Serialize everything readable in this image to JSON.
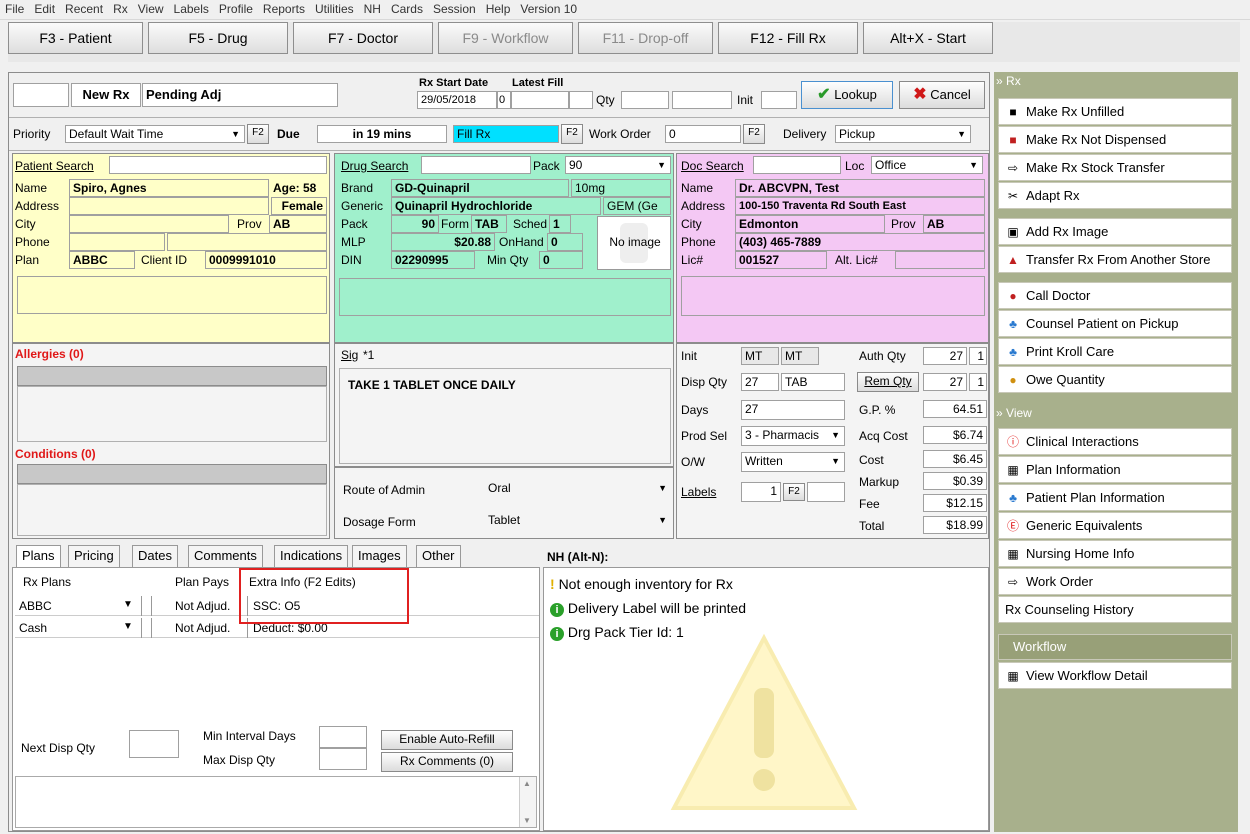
{
  "menu": [
    "File",
    "Edit",
    "Recent",
    "Rx",
    "View",
    "Labels",
    "Profile",
    "Reports",
    "Utilities",
    "NH",
    "Cards",
    "Session",
    "Help",
    "Version 10"
  ],
  "fkeys": [
    "F3 - Patient",
    "F5 - Drug",
    "F7 - Doctor",
    "F9 - Workflow",
    "F11 - Drop-off",
    "F12 - Fill Rx",
    "Alt+X - Start"
  ],
  "header": {
    "new_rx": "New Rx",
    "pending": "Pending Adj",
    "rx_start_label": "Rx Start Date",
    "latest_fill_label": "Latest Fill",
    "rx_start": "29/05/2018",
    "latest_fill": "0",
    "qty_label": "Qty",
    "init_label": "Init",
    "lookup": "Lookup",
    "cancel": "Cancel"
  },
  "priority": {
    "label": "Priority",
    "value": "Default Wait Time",
    "f2": "F2",
    "due_label": "Due",
    "due": "in 19 mins",
    "fill": "Fill Rx",
    "work_order_label": "Work Order",
    "work_order": "0",
    "delivery_label": "Delivery",
    "delivery": "Pickup"
  },
  "patient": {
    "search_label": "Patient Search",
    "name_label": "Name",
    "name": "Spiro, Agnes",
    "age": "Age: 58",
    "address_label": "Address",
    "gender": "Female",
    "city_label": "City",
    "prov_label": "Prov",
    "prov": "AB",
    "phone_label": "Phone",
    "plan_label": "Plan",
    "plan": "ABBC",
    "client_id_label": "Client ID",
    "client_id": "0009991010"
  },
  "drug": {
    "search_label": "Drug Search",
    "pack_label": "Pack",
    "pack": "90",
    "brand_label": "Brand",
    "brand": "GD-Quinapril",
    "strength": "10mg",
    "generic_label": "Generic",
    "generic": "Quinapril Hydrochloride",
    "gem": "GEM (Ge",
    "pack2_label": "Pack",
    "pack2": "90",
    "form_label": "Form",
    "form": "TAB",
    "sched_label": "Sched",
    "sched": "1",
    "mlp_label": "MLP",
    "mlp": "$20.88",
    "onhand_label": "OnHand",
    "onhand": "0",
    "din_label": "DIN",
    "din": "02290995",
    "minqty_label": "Min Qty",
    "minqty": "0",
    "no_image": "No image"
  },
  "doctor": {
    "search_label": "Doc Search",
    "loc_label": "Loc",
    "loc": "Office",
    "name_label": "Name",
    "name": "Dr. ABCVPN, Test",
    "address_label": "Address",
    "address": "100-150 Traventa Rd South East",
    "city_label": "City",
    "city": "Edmonton",
    "prov_label": "Prov",
    "prov": "AB",
    "phone_label": "Phone",
    "phone": "(403) 465-7889",
    "lic_label": "Lic#",
    "lic": "001527",
    "alt_lic_label": "Alt. Lic#"
  },
  "allergies": "Allergies (0)",
  "conditions": "Conditions (0)",
  "sig": {
    "label": "Sig",
    "value": "*1",
    "text": "TAKE 1 TABLET ONCE DAILY"
  },
  "route": {
    "route_label": "Route of Admin",
    "route": "Oral",
    "form_label": "Dosage Form",
    "form": "Tablet"
  },
  "dispense": {
    "init_label": "Init",
    "init1": "MT",
    "init2": "MT",
    "auth_label": "Auth Qty",
    "auth": "27",
    "auth2": "1",
    "disp_label": "Disp Qty",
    "disp": "27",
    "disp_unit": "TAB",
    "rem_label": "Rem Qty",
    "rem": "27",
    "rem2": "1",
    "days_label": "Days",
    "days": "27",
    "gp_label": "G.P. %",
    "gp": "64.51",
    "prod_label": "Prod Sel",
    "prod": "3 - Pharmacis",
    "acq_label": "Acq Cost",
    "acq": "$6.74",
    "ow_label": "O/W",
    "ow": "Written",
    "cost_label": "Cost",
    "cost": "$6.45",
    "labels_label": "Labels",
    "labels": "1",
    "f2": "F2",
    "markup_label": "Markup",
    "markup": "$0.39",
    "fee_label": "Fee",
    "fee": "$12.15",
    "total_label": "Total",
    "total": "$18.99"
  },
  "tabs": [
    "Plans",
    "Pricing",
    "Dates",
    "Comments",
    "Indications",
    "Images",
    "Other"
  ],
  "plans": {
    "col1": "Rx Plans",
    "col2": "Plan Pays",
    "col3": "Extra Info (F2 Edits)",
    "rows": [
      {
        "plan": "ABBC",
        "pays": "Not Adjud.",
        "info": "SSC: O5"
      },
      {
        "plan": "Cash",
        "pays": "Not Adjud.",
        "info": "Deduct: $0.00"
      }
    ],
    "next_disp_label": "Next Disp Qty",
    "min_interval_label": "Min Interval Days",
    "max_disp_label": "Max Disp Qty",
    "auto_refill": "Enable Auto-Refill",
    "rx_comments": "Rx Comments (0)"
  },
  "nh": {
    "title": "NH (Alt-N):",
    "messages": [
      "Not enough inventory for Rx",
      "Delivery Label will be printed",
      "Drg Pack Tier Id: 1"
    ]
  },
  "side": {
    "rx_header": "Rx",
    "rx_items": [
      "Make Rx Unfilled",
      "Make Rx Not Dispensed",
      "Make Rx Stock Transfer",
      "Adapt Rx",
      "Add Rx Image",
      "Transfer Rx From Another Store",
      "Call Doctor",
      "Counsel Patient on Pickup",
      "Print Kroll Care",
      "Owe Quantity"
    ],
    "view_header": "View",
    "view_items": [
      "Clinical Interactions",
      "Plan Information",
      "Patient Plan Information",
      "Generic Equivalents",
      "Nursing Home Info",
      "Work Order",
      "Rx Counseling History"
    ],
    "workflow_header": "Workflow",
    "workflow_items": [
      "View Workflow Detail"
    ]
  },
  "colors": {
    "accent_red": "#e02020",
    "patient_bg": "#ffffc8",
    "drug_bg": "#a0f0cc",
    "doctor_bg": "#f4c8f4",
    "fill_highlight": "#00e0ff"
  }
}
